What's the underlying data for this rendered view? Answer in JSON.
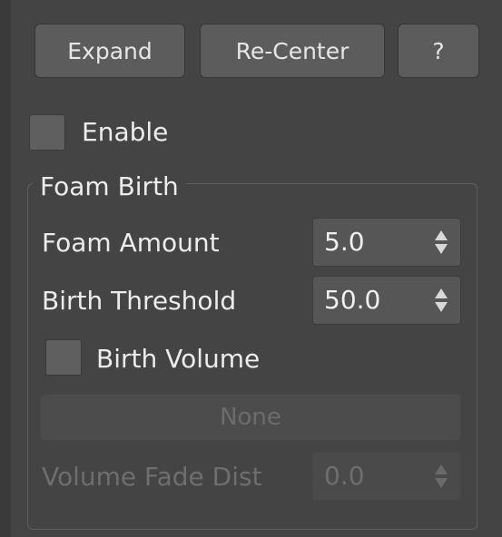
{
  "toolbar": {
    "expand_label": "Expand",
    "recenter_label": "Re-Center",
    "help_label": "?"
  },
  "enable": {
    "label": "Enable",
    "checked": false
  },
  "foam_birth": {
    "title": "Foam Birth",
    "foam_amount": {
      "label": "Foam Amount",
      "value": "5.0"
    },
    "birth_threshold": {
      "label": "Birth Threshold",
      "value": "50.0"
    },
    "birth_volume": {
      "label": "Birth Volume",
      "checked": false
    },
    "volume_picker": {
      "label": "None",
      "enabled": false
    },
    "volume_fade_dist": {
      "label": "Volume Fade Dist",
      "value": "0.0",
      "enabled": false
    }
  },
  "colors": {
    "background": "#444444",
    "button": "#5c5c5c",
    "text": "#ececec",
    "disabled_text": "#6e6e6e"
  }
}
